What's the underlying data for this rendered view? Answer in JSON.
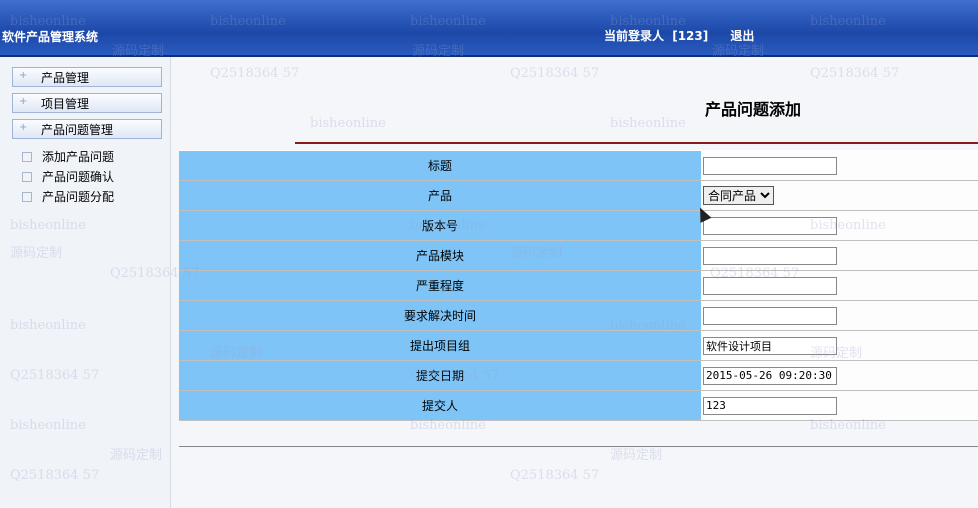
{
  "header": {
    "app_title": "软件产品管理系统",
    "login_label": "当前登录人",
    "login_user": "[123]",
    "logout_label": "退出"
  },
  "sidebar": {
    "groups": [
      {
        "label": "产品管理"
      },
      {
        "label": "项目管理"
      },
      {
        "label": "产品问题管理"
      }
    ],
    "sub_items": [
      {
        "label": "添加产品问题"
      },
      {
        "label": "产品问题确认"
      },
      {
        "label": "产品问题分配"
      }
    ]
  },
  "main": {
    "title": "产品问题添加",
    "fields": {
      "title": {
        "label": "标题",
        "value": ""
      },
      "product": {
        "label": "产品",
        "selected": "合同产品"
      },
      "version": {
        "label": "版本号",
        "value": ""
      },
      "module": {
        "label": "产品模块",
        "value": ""
      },
      "severity": {
        "label": "严重程度",
        "value": ""
      },
      "due_time": {
        "label": "要求解决时间",
        "value": ""
      },
      "project_group": {
        "label": "提出项目组",
        "value": "软件设计项目"
      },
      "submit_date": {
        "label": "提交日期",
        "value": "2015-05-26 09:20:30"
      },
      "submitter": {
        "label": "提交人",
        "value": "123"
      }
    }
  },
  "watermark": {
    "text_a": "bisheonline",
    "text_b": "源码定制",
    "text_c": "Q2518364 57"
  }
}
